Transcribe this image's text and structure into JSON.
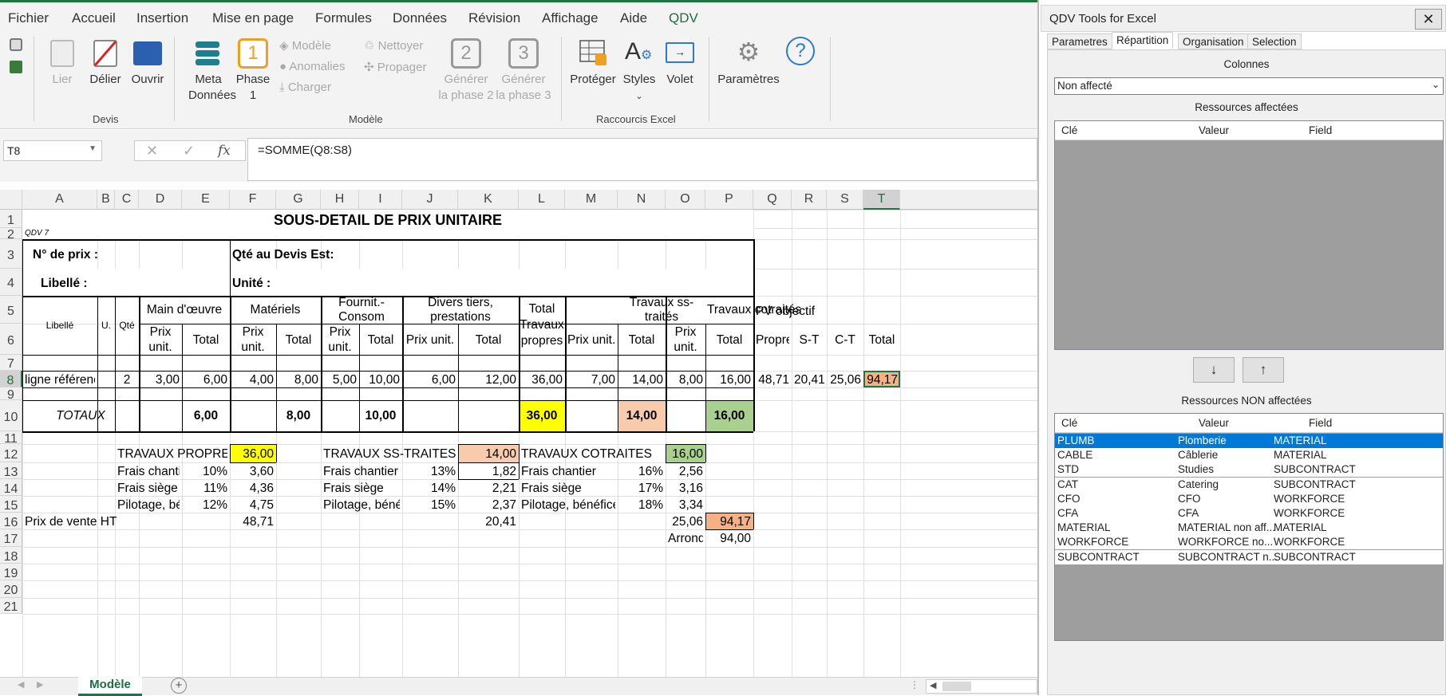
{
  "menu": {
    "items": [
      "Fichier",
      "Accueil",
      "Insertion",
      "Mise en page",
      "Formules",
      "Données",
      "Révision",
      "Affichage",
      "Aide",
      "QDV"
    ]
  },
  "ribbon": {
    "devis": {
      "lier": "Lier",
      "delier": "Délier",
      "ouvrir": "Ouvrir",
      "group": "Devis"
    },
    "modele": {
      "meta_l1": "Meta",
      "meta_l2": "Données",
      "phase_l1": "Phase",
      "phase_l2": "1",
      "phase_num": "1",
      "modele_btn": "Modèle",
      "anomalies": "Anomalies",
      "charger": "Charger",
      "nettoyer": "Nettoyer",
      "propager": "Propager",
      "gen2_l1": "Générer",
      "gen2_l2": "la phase 2",
      "gen2_num": "2",
      "gen3_l1": "Générer",
      "gen3_l2": "la phase 3",
      "gen3_num": "3",
      "group": "Modèle"
    },
    "raccourcis": {
      "proteger": "Protéger",
      "styles": "Styles",
      "volet": "Volet",
      "group": "Raccourcis Excel"
    },
    "parametres": "Paramètres"
  },
  "formula_bar": {
    "name_box": "T8",
    "formula": "=SOMME(Q8:S8)",
    "fx": "fx"
  },
  "columns": [
    "A",
    "B",
    "C",
    "D",
    "E",
    "F",
    "G",
    "H",
    "I",
    "J",
    "K",
    "L",
    "M",
    "N",
    "O",
    "P",
    "Q",
    "R",
    "S",
    "T"
  ],
  "rows": [
    "1",
    "2",
    "3",
    "4",
    "5",
    "6",
    "7",
    "8",
    "9",
    "10",
    "11",
    "12",
    "13",
    "14",
    "15",
    "16",
    "17",
    "18",
    "19",
    "20",
    "21"
  ],
  "sheet": {
    "title": "SOUS-DETAIL DE PRIX UNITAIRE",
    "qdv": "QDV 7",
    "no_prix": "N° de prix :",
    "qte_devis": "Qté au Devis Est:",
    "libelle_lbl": "Libellé :",
    "unite": "Unité :",
    "h_libelle": "Libellé",
    "h_u": "U.",
    "h_qte": "Qté",
    "h_mo": "Main d'œuvre",
    "h_mat": "Matériels",
    "h_fourn": "Fournit.-Consom",
    "h_divers": "Divers tiers, prestations",
    "h_total": "Total",
    "h_travaux": "Travaux",
    "h_propres": "propres",
    "h_sst": "Travaux ss-traités",
    "h_cot": "Travaux cotraités",
    "h_pv": "PV objectif",
    "h_prix": "Prix",
    "h_unit": "unit.",
    "h_tot": "Total",
    "h_prixunit": "Prix unit.",
    "h_propre": "Propre",
    "h_st": "S-T",
    "h_ct": "C-T",
    "r8": {
      "lib": "ligne référence",
      "qte": "2",
      "d": "3,00",
      "e": "6,00",
      "f": "4,00",
      "g": "8,00",
      "h": "5,00",
      "i": "10,00",
      "j": "6,00",
      "k": "12,00",
      "l": "36,00",
      "m": "7,00",
      "n": "14,00",
      "o": "8,00",
      "p": "16,00",
      "q": "48,71",
      "r": "20,41",
      "s": "25,06",
      "t": "94,17"
    },
    "r10": {
      "lbl": "TOTAUX",
      "e": "6,00",
      "g": "8,00",
      "i": "10,00",
      "l": "36,00",
      "n": "14,00",
      "p": "16,00"
    },
    "tp": {
      "lbl": "TRAVAUX PROPRES",
      "val": "36,00",
      "fc": "Frais chantier",
      "fc_pct": "10%",
      "fc_v": "3,60",
      "fs": "Frais siège",
      "fs_pct": "11%",
      "fs_v": "4,36",
      "pb": "Pilotage, bénéfi",
      "pb_pct": "12%",
      "pb_v": "4,75",
      "pv": "48,71"
    },
    "st": {
      "lbl": "TRAVAUX SS-TRAITES",
      "val": "14,00",
      "fc": "Frais chantier",
      "fc_pct": "13%",
      "fc_v": "1,82",
      "fs": "Frais siège",
      "fs_pct": "14%",
      "fs_v": "2,21",
      "pb": "Pilotage, bénéfi",
      "pb_pct": "15%",
      "pb_v": "2,37",
      "pv": "20,41"
    },
    "ct": {
      "lbl": "TRAVAUX COTRAITES",
      "val": "16,00",
      "fc": "Frais chantier",
      "fc_pct": "16%",
      "fc_v": "2,56",
      "fs": "Frais siège",
      "fs_pct": "17%",
      "fs_v": "3,16",
      "pb": "Pilotage, bénéfice",
      "pb_pct": "18%",
      "pb_v": "3,34",
      "pv": "25,06"
    },
    "pvht": "Prix de vente HT",
    "total": "94,17",
    "arrondi": "Arrondi",
    "arrondi_v": "94,00"
  },
  "tabs": {
    "active": "Modèle"
  },
  "panel": {
    "title": "QDV Tools for Excel",
    "close": "✕",
    "tabs": [
      "Parametres",
      "Répartition",
      "Organisation",
      "Selection"
    ],
    "colonnes": "Colonnes",
    "dropdown": "Non affecté",
    "affectees": "Ressources affectées",
    "non_affectees": "Ressources NON affectées",
    "headers": [
      "Clé",
      "Valeur",
      "Field"
    ],
    "down": "↓",
    "up": "↑",
    "rows": [
      {
        "cle": "PLUMB",
        "valeur": "Plomberie",
        "field": "MATERIAL"
      },
      {
        "cle": "CABLE",
        "valeur": "Câblerie",
        "field": "MATERIAL"
      },
      {
        "cle": "STD",
        "valeur": "Studies",
        "field": "SUBCONTRACT"
      },
      {
        "cle": "CAT",
        "valeur": "Catering",
        "field": "SUBCONTRACT"
      },
      {
        "cle": "CFO",
        "valeur": "CFO",
        "field": "WORKFORCE"
      },
      {
        "cle": "CFA",
        "valeur": "CFA",
        "field": "WORKFORCE"
      },
      {
        "cle": "MATERIAL",
        "valeur": "MATERIAL non aff...",
        "field": "MATERIAL"
      },
      {
        "cle": "WORKFORCE",
        "valeur": "WORKFORCE no...",
        "field": "WORKFORCE"
      },
      {
        "cle": "SUBCONTRACT",
        "valeur": "SUBCONTRACT n...",
        "field": "SUBCONTRACT"
      }
    ]
  },
  "colors": {
    "excel_green": "#217346",
    "yellow": "#ffff00",
    "salmon": "#f8cbad",
    "green_fill": "#a9d08e",
    "orange": "#f4b183",
    "selection": "#0078d7"
  }
}
